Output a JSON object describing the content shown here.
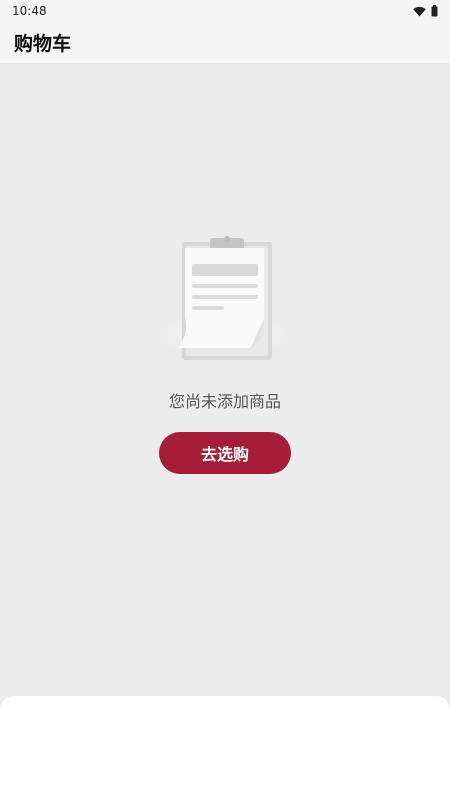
{
  "status_bar": {
    "time": "10:48",
    "icons": [
      "wifi-icon",
      "battery-icon"
    ]
  },
  "header": {
    "title": "购物车"
  },
  "empty_state": {
    "icon": "clipboard-icon",
    "message": "您尚未添加商品",
    "button_label": "去选购"
  },
  "colors": {
    "accent": "#a61d38",
    "background": "#ececec",
    "header_background": "#f5f5f5"
  }
}
